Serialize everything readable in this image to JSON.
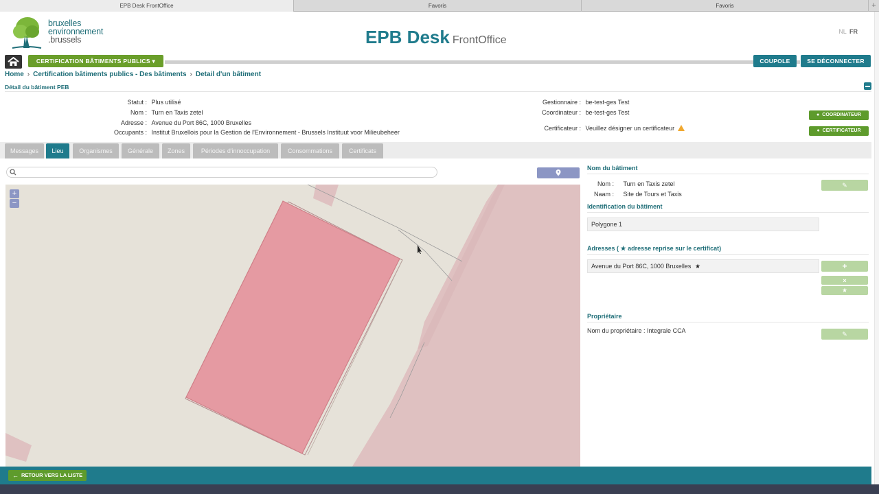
{
  "browser": {
    "tabs": [
      "EPB Desk FrontOffice",
      "Favoris",
      "Favoris"
    ]
  },
  "header": {
    "logo_line1": "bruxelles",
    "logo_line2": "environnement",
    "logo_line3": ".brussels",
    "title": "EPB Desk",
    "subtitle": "FrontOffice",
    "lang_nl": "NL",
    "lang_fr": "FR"
  },
  "nav": {
    "cert_menu": "CERTIFICATION BÂTIMENTS PUBLICS ▾",
    "coupole": "COUPOLE",
    "logout": "SE DÉCONNECTER"
  },
  "breadcrumb": [
    "Home",
    "Certification bâtiments publics - Des bâtiments",
    "Detail d'un bâtiment"
  ],
  "section_title": "Détail du bâtiment PEB",
  "info": {
    "statut_label": "Statut :",
    "statut": "Plus utilisé",
    "nom_label": "Nom :",
    "nom": "Turn en Taxis zetel",
    "adresse_label": "Adresse :",
    "adresse": "Avenue du Port 86C, 1000 Bruxelles",
    "occupants_label": "Occupants :",
    "occupants": "Institut Bruxellois pour la Gestion de l'Environnement - Brussels Instituut voor Milieubeheer",
    "gestionnaire_label": "Gestionnaire :",
    "gestionnaire": "be-test-ges Test",
    "coordinateur_label": "Coordinateur :",
    "coordinateur": "be-test-ges Test",
    "certificateur_label": "Certificateur :",
    "certificateur": "Veuillez désigner un certificateur",
    "btn_coordinateur": "COORDINATEUR",
    "btn_certificateur": "CERTIFICATEUR"
  },
  "tabs": [
    "Messages",
    "Lieu",
    "Organismes",
    "Générale",
    "Zones",
    "Périodes d'innoccupation",
    "Consommations",
    "Certificats"
  ],
  "active_tab": "Lieu",
  "map": {
    "zoom_in": "+",
    "zoom_out": "−"
  },
  "right_panel": {
    "nom_batiment_head": "Nom du bâtiment",
    "nom_label": "Nom :",
    "nom": "Turn en Taxis zetel",
    "naam_label": "Naam :",
    "naam": "Site de Tours et Taxis",
    "identification_head": "Identification du bâtiment",
    "polygone": "Polygone 1",
    "adresses_head": "Adresses ( ★ adresse reprise sur le certificat)",
    "adresse": "Avenue du Port 86C, 1000 Bruxelles",
    "proprietaire_head": "Propriétaire",
    "proprietaire": "Nom du propriétaire : Integrale CCA"
  },
  "footer": {
    "back": "RETOUR VERS LA LISTE"
  },
  "colors": {
    "teal": "#1f7b8c",
    "green": "#5e9b2c",
    "building_fill": "#e59aa2"
  }
}
